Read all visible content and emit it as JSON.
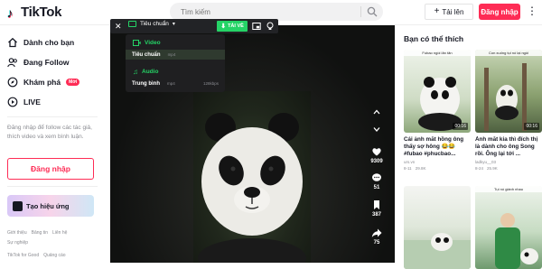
{
  "brand": {
    "name": "TikTok"
  },
  "search": {
    "placeholder": "Tìm kiếm"
  },
  "header": {
    "upload_label": "Tải lên",
    "login_label": "Đăng nhập"
  },
  "sidebar": {
    "items": [
      {
        "label": "Dành cho bạn",
        "icon": "home-icon"
      },
      {
        "label": "Đang Follow",
        "icon": "people-icon"
      },
      {
        "label": "Khám phá",
        "icon": "compass-icon",
        "badge": "Mới"
      },
      {
        "label": "LIVE",
        "icon": "live-icon"
      }
    ],
    "note": "Đăng nhập để follow các tác giả, thích video và xem bình luận.",
    "login_label": "Đăng nhập",
    "effect_label": "Tạo hiệu ứng",
    "footer_row1": [
      "Giới thiệu",
      "Bảng tin",
      "Liên hệ"
    ],
    "footer_row2": [
      "Sự nghiệp"
    ],
    "footer_row3": [
      "TikTok for Good",
      "Quảng cáo"
    ]
  },
  "quality_bar": {
    "quality_label": "Tiêu chuẩn",
    "download_label": "TẢI VỀ"
  },
  "dropdown": {
    "video_header": "Video",
    "video_option": "Tiêu chuẩn",
    "video_option_sub": "mp4",
    "audio_header": "Audio",
    "audio_option": "Trung bình",
    "audio_option_sub": "mp4",
    "audio_option_right": "128kbps"
  },
  "actions": {
    "likes": "9309",
    "comments": "51",
    "saves": "387",
    "shares": "75"
  },
  "recommended": {
    "title": "Bạn có thể thích",
    "cards": [
      {
        "thumb_label": "Fubao ngồi lăn tăn",
        "duration": "00:16",
        "caption": "Cái ảnh mắt hồng ông thấy sợ hông 😂😂 #fubao #phucbao...",
        "author": "urs.vn",
        "date": "8-11",
        "views": "29.8K",
        "colors": [
          "#e9f1e4",
          "#7fa86a"
        ]
      },
      {
        "thumb_label": "Con xuống tụi nó lại ngồi",
        "duration": "00:16",
        "caption": "Ảnh mắt kia thì đích thị là dành cho ông Song rồi. Ông lại tới ...",
        "author": "ladkyu__03",
        "date": "8-24",
        "views": "25.9K",
        "colors": [
          "#b7c9a6",
          "#5a6e47"
        ]
      },
      {
        "thumb_label": "",
        "duration": "",
        "caption": "",
        "author": "",
        "date": "",
        "views": "",
        "colors": [
          "#f2f4f1",
          "#9bb796"
        ]
      },
      {
        "thumb_label": "Tụi nó giành nhau",
        "duration": "",
        "caption": "",
        "author": "",
        "date": "",
        "views": "",
        "colors": [
          "#e3efe1",
          "#3f8e4d"
        ]
      }
    ]
  }
}
